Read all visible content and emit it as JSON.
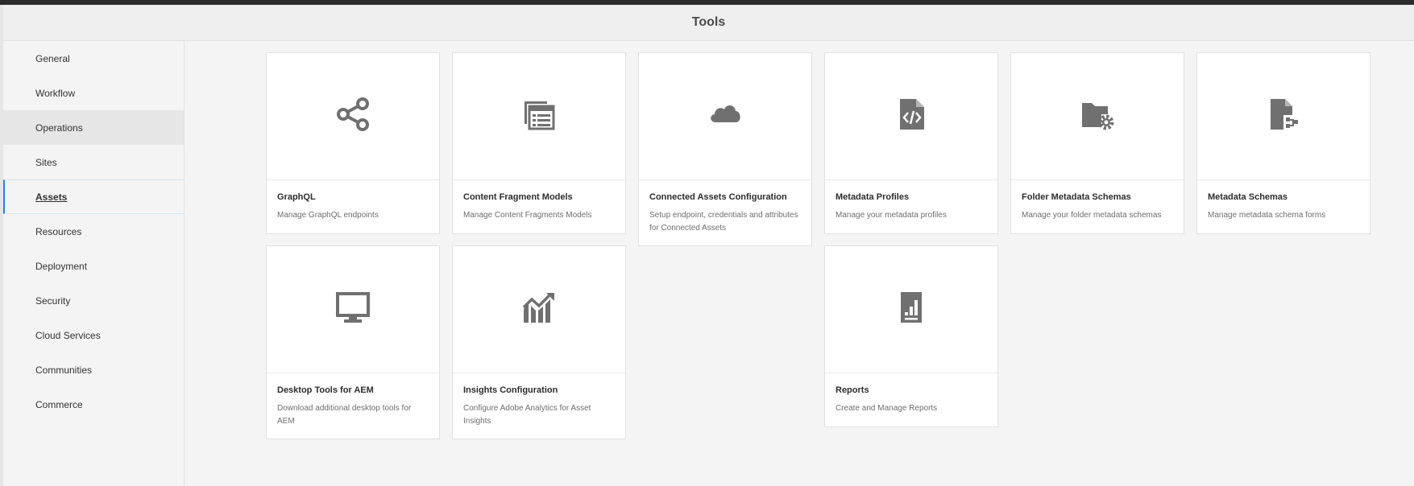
{
  "header": {
    "title": "Tools"
  },
  "sidebar": {
    "items": [
      {
        "label": "General"
      },
      {
        "label": "Workflow"
      },
      {
        "label": "Operations"
      },
      {
        "label": "Sites"
      },
      {
        "label": "Assets"
      },
      {
        "label": "Resources"
      },
      {
        "label": "Deployment"
      },
      {
        "label": "Security"
      },
      {
        "label": "Cloud Services"
      },
      {
        "label": "Communities"
      },
      {
        "label": "Commerce"
      }
    ]
  },
  "cards": [
    {
      "title": "GraphQL",
      "description": "Manage GraphQL endpoints",
      "icon": "share-icon"
    },
    {
      "title": "Content Fragment Models",
      "description": "Manage Content Fragments Models",
      "icon": "fragments-icon"
    },
    {
      "title": "Connected Assets Configuration",
      "description": "Setup endpoint, credentials and attributes for Connected Assets",
      "icon": "cloud-icon"
    },
    {
      "title": "Metadata Profiles",
      "description": "Manage your metadata profiles",
      "icon": "code-file-icon"
    },
    {
      "title": "Folder Metadata Schemas",
      "description": "Manage your folder metadata schemas",
      "icon": "folder-gear-icon"
    },
    {
      "title": "Metadata Schemas",
      "description": "Manage metadata schema forms",
      "icon": "schema-file-icon"
    },
    {
      "title": "Desktop Tools for AEM",
      "description": "Download additional desktop tools for AEM",
      "icon": "monitor-icon"
    },
    {
      "title": "Insights Configuration",
      "description": "Configure Adobe Analytics for Asset Insights",
      "icon": "chart-trend-icon"
    },
    {
      "title": "Reports",
      "description": "Create and Manage Reports",
      "icon": "report-icon"
    }
  ],
  "colors": {
    "icon": "#707070",
    "active_accent": "#2680eb"
  }
}
